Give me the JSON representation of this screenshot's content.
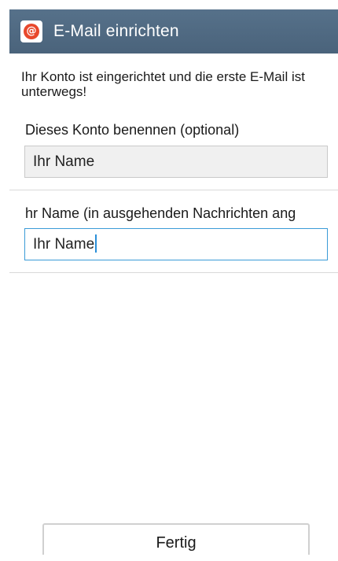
{
  "header": {
    "app_icon": "email-at-icon",
    "icon_glyph": "@",
    "title": "E-Mail einrichten",
    "bar_color": "#4f6a83"
  },
  "intro": {
    "text": "Ihr Konto ist eingerichtet und die erste E-Mail ist unterwegs!"
  },
  "account_name": {
    "label": "Dieses Konto benennen (optional)",
    "value": "Ihr Name"
  },
  "sender_name": {
    "label": "hr Name (in ausgehenden Nachrichten ang",
    "value": "Ihr Name",
    "focused": true,
    "focus_color": "#3a9bd7"
  },
  "footer": {
    "done_label": "Fertig"
  }
}
